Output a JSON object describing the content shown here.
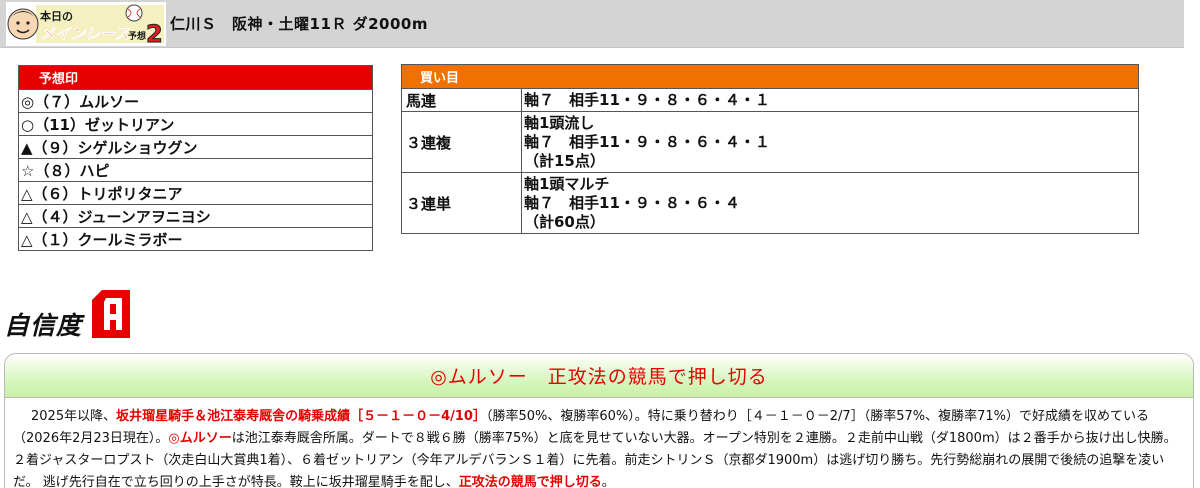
{
  "header": {
    "logo_text": "本日のメインレース予想2",
    "title": "仁川Ｓ　阪神・土曜11Ｒ ダ2000m"
  },
  "yoso": {
    "heading": "予想印",
    "rows": [
      "◎（７）ムルソー",
      "○（11）ゼットリアン",
      "▲（９）シゲルショウグン",
      "☆（８）ハピ",
      "△（６）トリポリタニア",
      "△（４）ジューンアヲニヨシ",
      "△（１）クールミラボー"
    ]
  },
  "kaime": {
    "heading": "買い目",
    "rows": [
      {
        "bet": "馬連",
        "lines": [
          "軸７　相手11・９・８・６・４・１"
        ]
      },
      {
        "bet": "３連複",
        "lines": [
          "軸1頭流し",
          "軸７　相手11・９・８・６・４・１",
          "（計15点）"
        ]
      },
      {
        "bet": "３連単",
        "lines": [
          "軸1頭マルチ",
          "軸７　相手11・９・８・６・４",
          "（計60点）"
        ]
      }
    ]
  },
  "confidence": {
    "label": "自信度",
    "rank": "A"
  },
  "comment": {
    "title": "◎ムルソー　正攻法の競馬で押し切る",
    "p1": "2025年以降、",
    "p2": "坂井瑠星騎手＆池江泰寿厩舎の騎乗成績［５－１－０－4/10］",
    "p3": "（勝率50%、複勝率60%）。特に乗り替わり［４－１－０－2/7］（勝率57%、複勝率71%）で好成績を収めている（2026年2月23日現在）。",
    "p4": "◎ムルソー",
    "p5": "は池江泰寿厩舎所属。ダートで８戦６勝（勝率75%）と底を見せていない大器。オープン特別を２連勝。２走前中山戦（ダ1800m）は２番手から抜け出し快勝。２着ジャスターロプスト（次走白山大賞典1着）、６着ゼットリアン（今年アルデバランＳ１着）に先着。前走シトリンＳ（京都ダ1900m）は逃げ切り勝ち。先行勢総崩れの展開で後続の追撃を凌いだ。 逃げ先行自在で立ち回りの上手さが特長。鞍上に坂井瑠星騎手を配し、",
    "p6": "正攻法の競馬で押し切る",
    "p7": "。"
  },
  "colors": {
    "yoso_header": "#e60000",
    "kaime_header": "#f07000",
    "comment_title": "#e60000",
    "header_bg": "#d4d4d4"
  }
}
